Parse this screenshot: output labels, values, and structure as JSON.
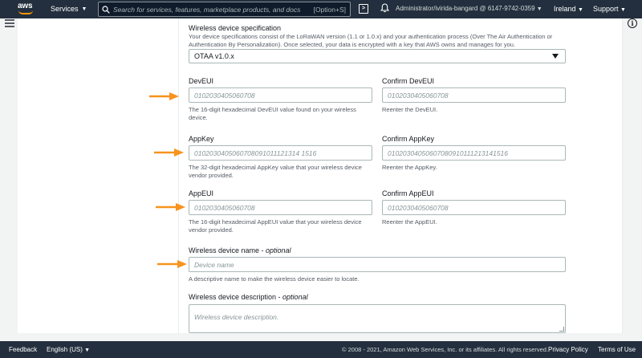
{
  "nav": {
    "logo": "aws",
    "services": "Services",
    "search_placeholder": "Search for services, features, marketplace products, and docs",
    "search_shortcut": "[Option+S]",
    "account": "Administrator/ivirida-bangard @ 6147-9742-0359",
    "region": "Ireland",
    "support": "Support"
  },
  "form": {
    "spec": {
      "label": "Wireless device specification",
      "description": "Your device specifications consist of the LoRaWAN version (1.1 or 1.0.x) and your authentication process (Over The Air Authentication or Authentication By Personalization). Once selected, your data is encrypted with a key that AWS owns and manages for you.",
      "value": "OTAA v1.0.x"
    },
    "deveui": {
      "label": "DevEUI",
      "placeholder": "0102030405060708",
      "description": "The 16-digit hexadecimal DevEUI value found on your wireless device.",
      "confirm_label": "Confirm DevEUI",
      "confirm_placeholder": "0102030405060708",
      "confirm_description": "Reenter the DevEUI."
    },
    "appkey": {
      "label": "AppKey",
      "placeholder": "0102030405060708091011121314 1516",
      "description": "The 32-digit hexadecimal AppKey value that your wireless device vendor provided.",
      "confirm_label": "Confirm AppKey",
      "confirm_placeholder": "01020304050607080910111213141516",
      "confirm_description": "Reenter the AppKey."
    },
    "appeui": {
      "label": "AppEUI",
      "placeholder": "0102030405060708",
      "description": "The 16-digit hexadecimal AppEUI value that your wireless device vendor provided.",
      "confirm_label": "Confirm AppEUI",
      "confirm_placeholder": "0102030405060708",
      "confirm_description": "Reenter the AppEUI."
    },
    "name": {
      "label": "Wireless device name",
      "optional": "optional",
      "placeholder": "Device name",
      "description": "A descriptive name to make the wireless device easier to locate."
    },
    "desc": {
      "label": "Wireless device description",
      "optional": "optional",
      "placeholder": "Wireless device description."
    }
  },
  "footer": {
    "feedback": "Feedback",
    "language": "English (US)",
    "copyright": "© 2008 - 2021, Amazon Web Services, Inc. or its affiliates. All rights reserved.",
    "privacy": "Privacy Policy",
    "terms": "Terms of Use"
  },
  "colors": {
    "nav_bg": "#232f3e",
    "arrow": "#f7931e"
  }
}
